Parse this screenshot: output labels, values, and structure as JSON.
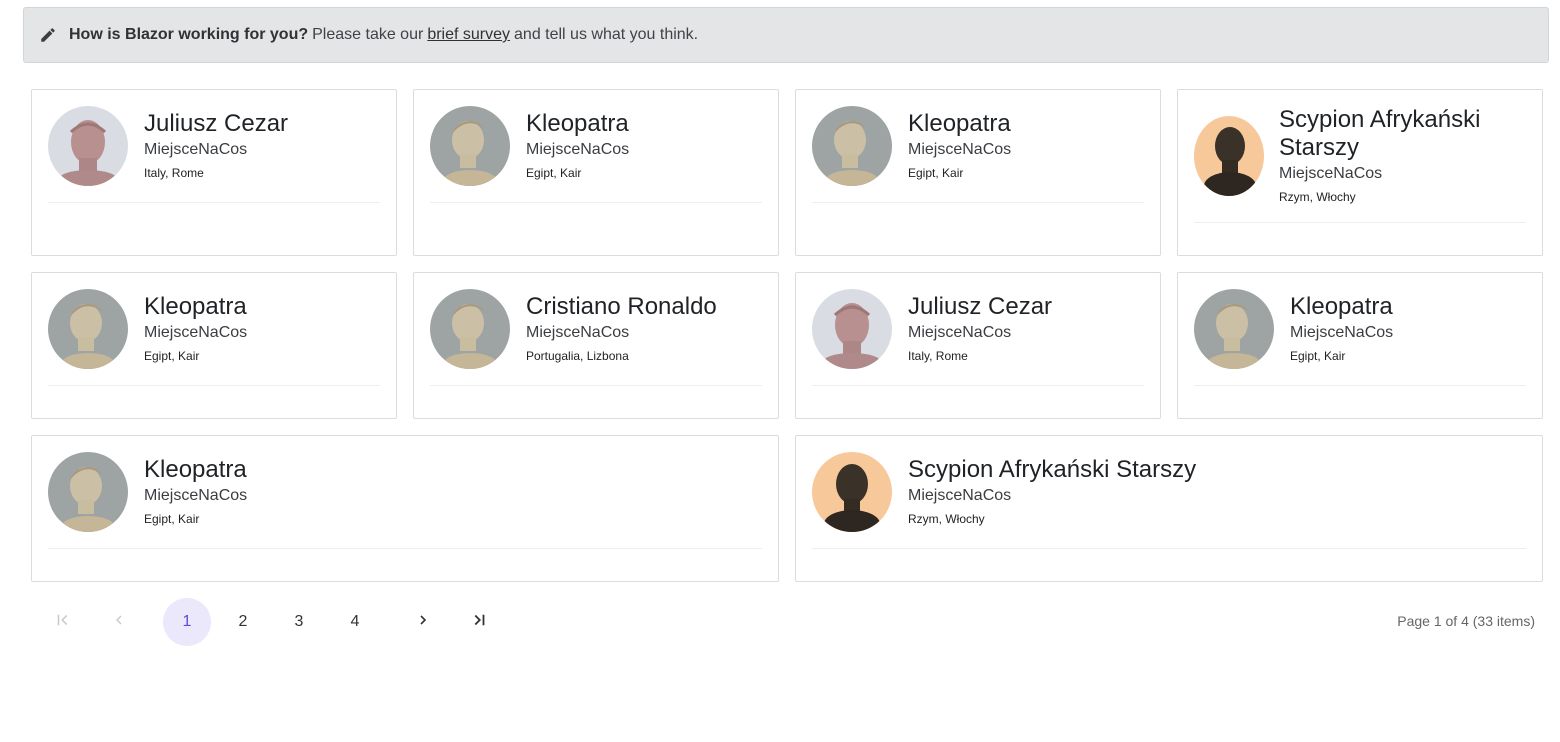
{
  "banner": {
    "bold": "How is Blazor working for you?",
    "pre": "Please take our",
    "link": "brief survey",
    "post": "and tell us what you think."
  },
  "cards": [
    {
      "name": "Juliusz Cezar",
      "place": "MiejsceNaCos",
      "location": "Italy, Rome",
      "portrait": "caesar-bust"
    },
    {
      "name": "Kleopatra",
      "place": "MiejsceNaCos",
      "location": "Egipt, Kair",
      "portrait": "cleopatra-bust"
    },
    {
      "name": "Kleopatra",
      "place": "MiejsceNaCos",
      "location": "Egipt, Kair",
      "portrait": "cleopatra-bust"
    },
    {
      "name": "Scypion Afrykański Starszy",
      "place": "MiejsceNaCos",
      "location": "Rzym, Włochy",
      "portrait": "scipio-bust"
    },
    {
      "name": "Kleopatra",
      "place": "MiejsceNaCos",
      "location": "Egipt, Kair",
      "portrait": "cleopatra-bust"
    },
    {
      "name": "Cristiano Ronaldo",
      "place": "MiejsceNaCos",
      "location": "Portugalia, Lizbona",
      "portrait": "cleopatra-bust"
    },
    {
      "name": "Juliusz Cezar",
      "place": "MiejsceNaCos",
      "location": "Italy, Rome",
      "portrait": "caesar-bust"
    },
    {
      "name": "Kleopatra",
      "place": "MiejsceNaCos",
      "location": "Egipt, Kair",
      "portrait": "cleopatra-bust"
    },
    {
      "name": "Kleopatra",
      "place": "MiejsceNaCos",
      "location": "Egipt, Kair",
      "portrait": "cleopatra-bust"
    },
    {
      "name": "Scypion Afrykański Starszy",
      "place": "MiejsceNaCos",
      "location": "Rzym, Włochy",
      "portrait": "scipio-bust"
    }
  ],
  "pager": {
    "pages": [
      "1",
      "2",
      "3",
      "4"
    ],
    "current": "1",
    "summary": "Page 1 of 4 (33 items)",
    "icons": [
      "first-page-icon",
      "prev-page-icon",
      "next-page-icon",
      "last-page-icon"
    ]
  },
  "colors": {
    "banner_bg": "#e4e5e7",
    "active_page_bg": "#ebe8fb",
    "active_page_fg": "#5b4bd6"
  }
}
